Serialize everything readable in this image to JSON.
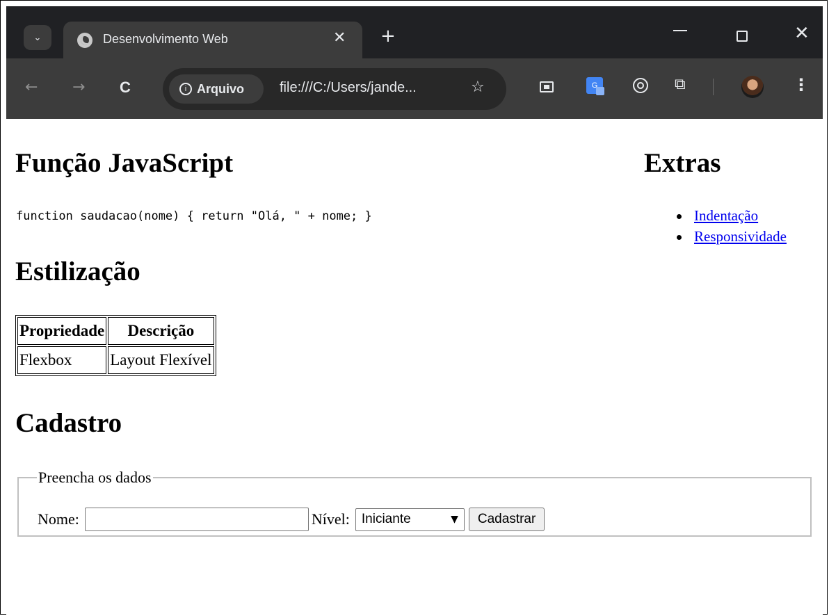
{
  "browser": {
    "tab_title": "Desenvolvimento Web",
    "tab_close": "✕",
    "new_tab": "+",
    "window_close": "✕",
    "site_info_label": "Arquivo",
    "url": "file:///C:/Users/jande...",
    "star": "☆",
    "nav_back": "←",
    "nav_forward": "→",
    "nav_reload": "C",
    "menu": "⋮",
    "icons": [
      "tab-search-icon",
      "globe-icon",
      "picture-in-picture-icon",
      "translate-icon",
      "target-icon",
      "puzzle-icon",
      "profile-avatar-icon"
    ]
  },
  "page": {
    "js_heading": "Função JavaScript",
    "code": "function saudacao(nome) { return \"Olá, \" + nome; }",
    "extras_heading": "Extras",
    "extras_links": [
      "Indentação",
      "Responsividade"
    ],
    "style_heading": "Estilização",
    "table": {
      "headers": [
        "Propriedade",
        "Descrição"
      ],
      "rows": [
        [
          "Flexbox",
          "Layout Flexível"
        ]
      ]
    },
    "signup_heading": "Cadastro",
    "fieldset_legend": "Preencha os dados",
    "name_label": "Nome:",
    "name_value": "",
    "level_label": "Nível:",
    "level_selected": "Iniciante",
    "submit_label": "Cadastrar"
  },
  "colors": {
    "tabstrip_bg": "#202124",
    "toolbar_bg": "#3c3c3c",
    "link": "#0000ee"
  }
}
